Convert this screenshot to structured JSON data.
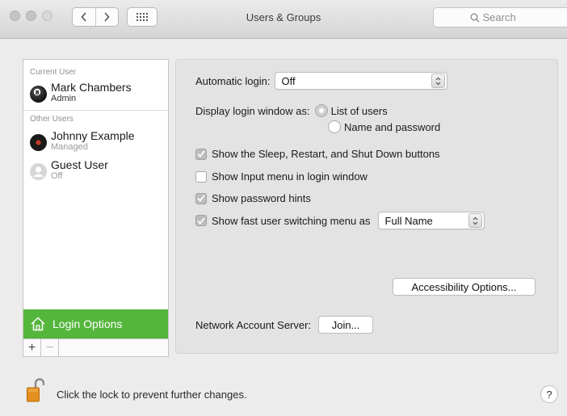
{
  "window": {
    "title": "Users & Groups",
    "search_placeholder": "Search"
  },
  "icons": {
    "back": "chevron-left-icon",
    "forward": "chevron-right-icon",
    "show_all": "grid-icon",
    "search": "magnifier-icon",
    "home": "house-icon",
    "lock": "lock-open-icon"
  },
  "colors": {
    "accent_selection": "#55b63c",
    "checkbox_checked": "#bdbdbd"
  },
  "sidebar": {
    "current_user_label": "Current User",
    "current_user": {
      "name": "Mark Chambers",
      "role": "Admin"
    },
    "other_users_label": "Other Users",
    "other_users": [
      {
        "name": "Johnny Example",
        "role": "Managed"
      },
      {
        "name": "Guest User",
        "role": "Off"
      }
    ],
    "login_options_label": "Login Options",
    "add_label": "+",
    "remove_label": "−"
  },
  "panel": {
    "automatic_login_label": "Automatic login:",
    "automatic_login_value": "Off",
    "display_login_label": "Display login window as:",
    "display_options": [
      {
        "label": "List of users",
        "selected": true
      },
      {
        "label": "Name and password",
        "selected": false
      }
    ],
    "checkboxes": [
      {
        "label": "Show the Sleep, Restart, and Shut Down buttons",
        "checked": true
      },
      {
        "label": "Show Input menu in login window",
        "checked": false
      },
      {
        "label": "Show password hints",
        "checked": true
      },
      {
        "label": "Show fast user switching menu as",
        "checked": true
      }
    ],
    "fast_switch_value": "Full Name",
    "accessibility_button": "Accessibility Options...",
    "network_server_label": "Network Account Server:",
    "join_button": "Join..."
  },
  "footer": {
    "lock_text": "Click the lock to prevent further changes.",
    "help_label": "?"
  }
}
